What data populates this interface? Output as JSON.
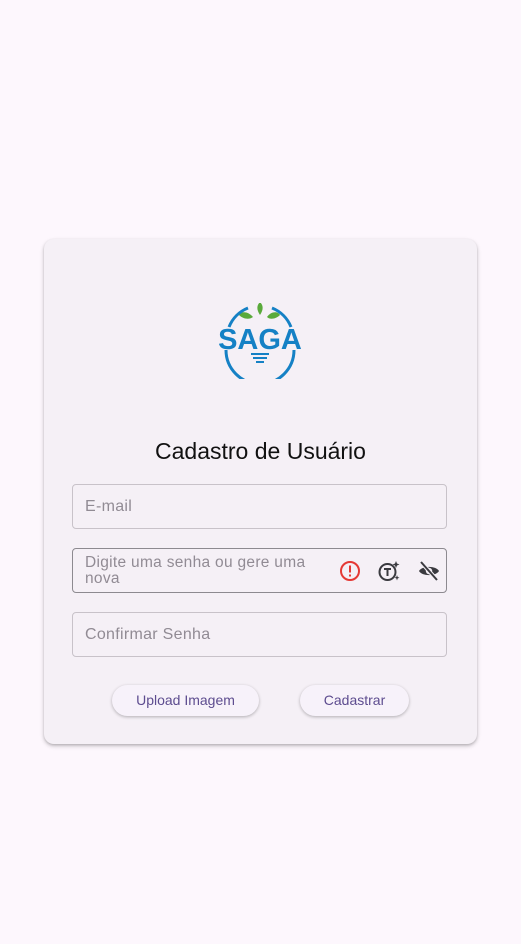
{
  "logo": {
    "text": "SAGA"
  },
  "form": {
    "title": "Cadastro de Usuário",
    "email_placeholder": "E-mail",
    "password_placeholder": "Digite uma senha ou gere uma nova",
    "confirm_placeholder": "Confirmar Senha"
  },
  "buttons": {
    "upload_label": "Upload Imagem",
    "submit_label": "Cadastrar"
  },
  "icons": {
    "error": "error-outline-icon",
    "generate": "text-auto-generate-icon",
    "visibility": "visibility-off-icon"
  },
  "colors": {
    "background": "#fdf7fd",
    "card": "#f5f0f6",
    "brand_blue": "#1581c5",
    "leaf_green": "#5aaa3b",
    "error_red": "#e53935",
    "button_text": "#5d4c8f"
  }
}
